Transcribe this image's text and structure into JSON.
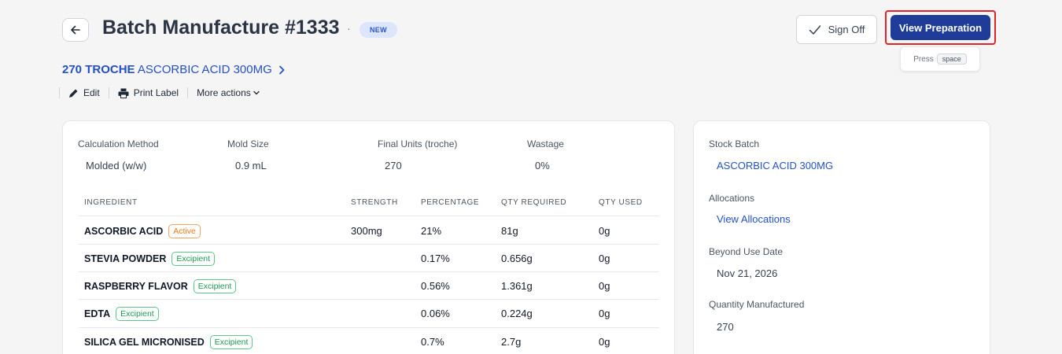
{
  "header": {
    "title": "Batch Manufacture #1333",
    "separator": "·",
    "status_badge": "NEW",
    "sign_off_label": "Sign Off",
    "view_preparation_label": "View Preparation",
    "shortcut_hint_prefix": "Press",
    "shortcut_key": "space"
  },
  "product": {
    "quantity_name": "270 TROCHE",
    "name": "ASCORBIC ACID 300MG"
  },
  "actions": {
    "edit_label": "Edit",
    "print_label": "Print Label",
    "more_label": "More actions"
  },
  "summary": {
    "calculation_method_label": "Calculation Method",
    "calculation_method_value": "Molded (w/w)",
    "mold_size_label": "Mold Size",
    "mold_size_value": "0.9 mL",
    "final_units_label": "Final Units (troche)",
    "final_units_value": "270",
    "wastage_label": "Wastage",
    "wastage_value": "0%"
  },
  "table": {
    "columns": [
      "INGREDIENT",
      "STRENGTH",
      "PERCENTAGE",
      "QTY REQUIRED",
      "QTY USED"
    ],
    "rows": [
      {
        "ingredient": "ASCORBIC ACID",
        "tag": "Active",
        "tag_type": "active",
        "strength": "300mg",
        "percentage": "21%",
        "qty_required": "81g",
        "qty_used": "0g"
      },
      {
        "ingredient": "STEVIA POWDER",
        "tag": "Excipient",
        "tag_type": "excipient",
        "strength": "",
        "percentage": "0.17%",
        "qty_required": "0.656g",
        "qty_used": "0g"
      },
      {
        "ingredient": "RASPBERRY FLAVOR",
        "tag": "Excipient",
        "tag_type": "excipient",
        "strength": "",
        "percentage": "0.56%",
        "qty_required": "1.361g",
        "qty_used": "0g"
      },
      {
        "ingredient": "EDTA",
        "tag": "Excipient",
        "tag_type": "excipient",
        "strength": "",
        "percentage": "0.06%",
        "qty_required": "0.224g",
        "qty_used": "0g"
      },
      {
        "ingredient": "SILICA GEL MICRONISED",
        "tag": "Excipient",
        "tag_type": "excipient",
        "strength": "",
        "percentage": "0.7%",
        "qty_required": "2.7g",
        "qty_used": "0g"
      }
    ]
  },
  "side": {
    "stock_batch_label": "Stock Batch",
    "stock_batch_value": "ASCORBIC ACID 300MG",
    "allocations_label": "Allocations",
    "allocations_link": "View Allocations",
    "beyond_use_label": "Beyond Use Date",
    "beyond_use_value": "Nov 21, 2026",
    "qty_manufactured_label": "Quantity Manufactured",
    "qty_manufactured_value": "270"
  },
  "colors": {
    "primary": "#1f3c99",
    "link": "#2450c6",
    "active_tag": "#f07a14",
    "excipient_tag": "#1f9a52",
    "highlight_outline": "#e0242c"
  },
  "icons": [
    "arrow-left-icon",
    "check-icon",
    "pencil-icon",
    "printer-icon",
    "chevron-right-icon",
    "chevron-down-icon"
  ]
}
